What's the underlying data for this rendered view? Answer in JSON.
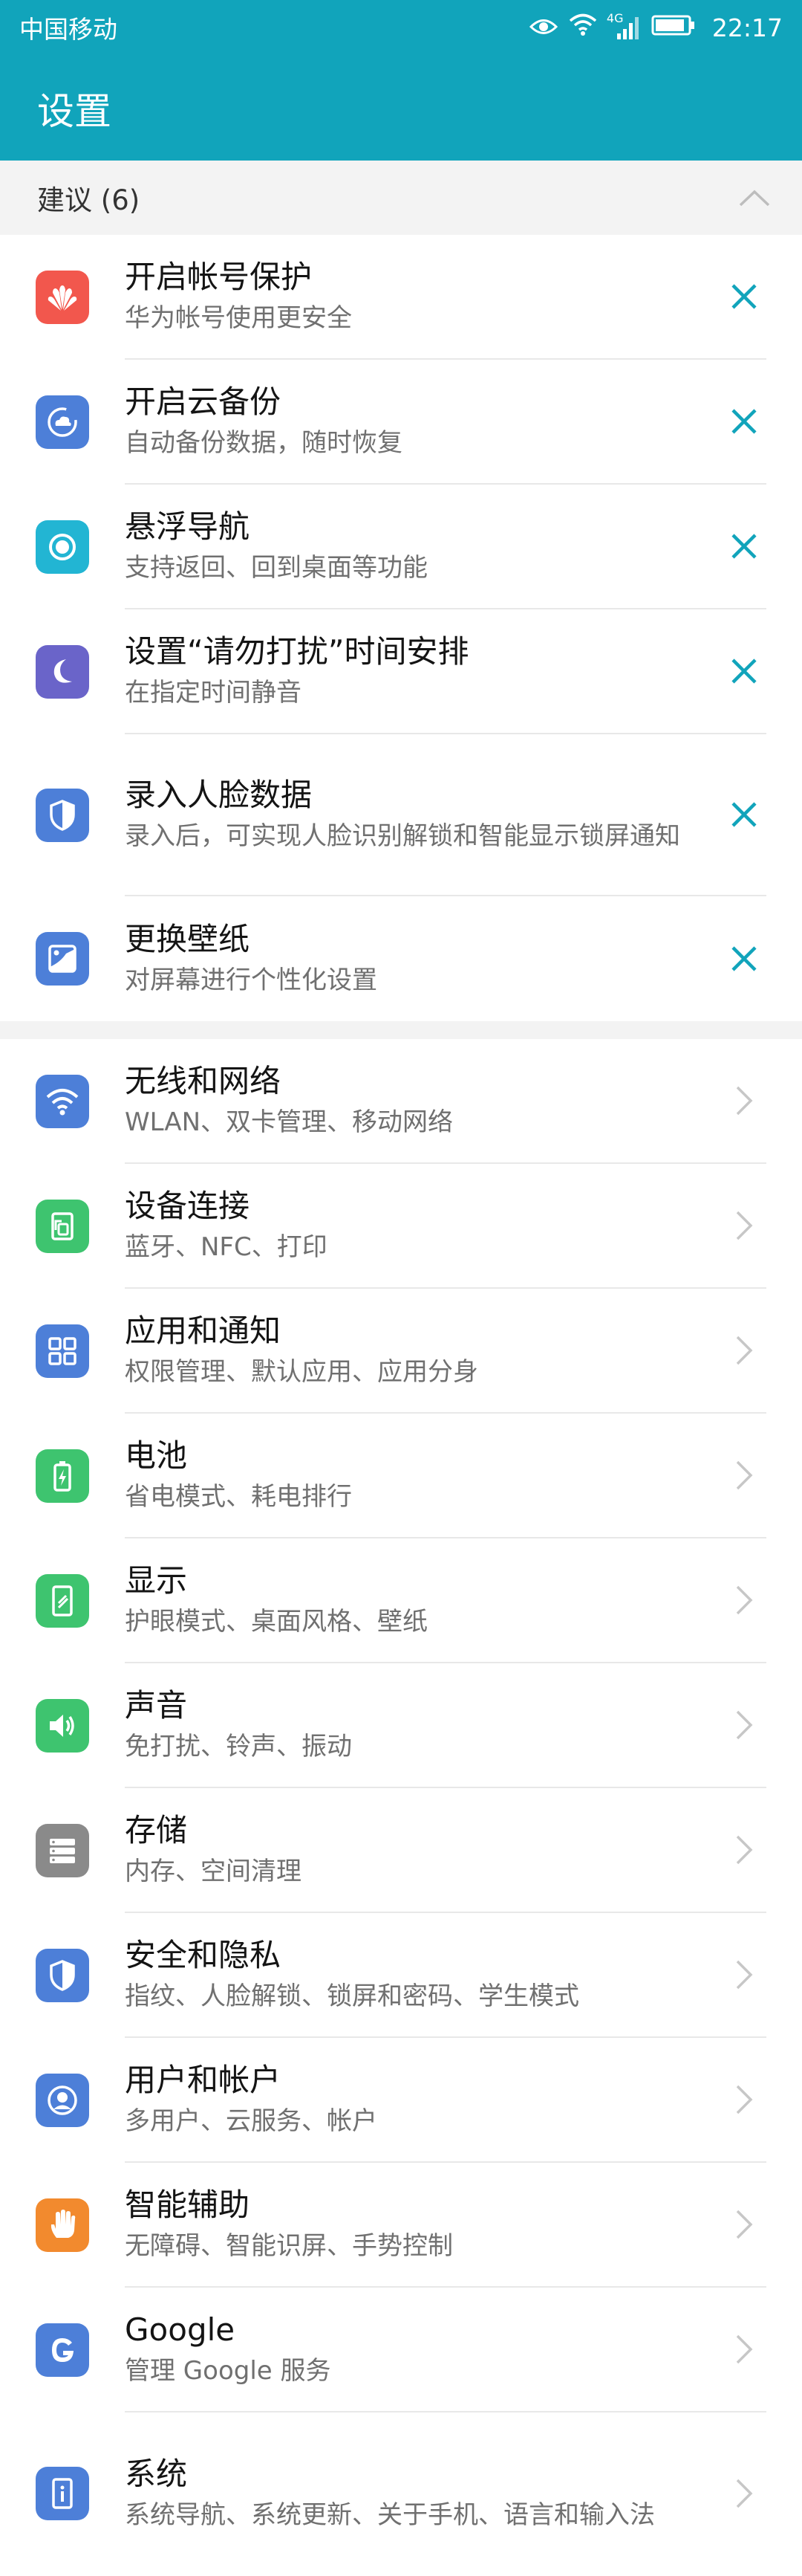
{
  "status_bar": {
    "carrier": "中国移动",
    "time": "22:17",
    "network": "4G"
  },
  "header": {
    "title": "设置"
  },
  "suggestions": {
    "label": "建议 (6)",
    "items": [
      {
        "title": "开启帐号保护",
        "subtitle": "华为帐号使用更安全",
        "icon": "huawei-logo-icon",
        "color": "#f2574d"
      },
      {
        "title": "开启云备份",
        "subtitle": "自动备份数据，随时恢复",
        "icon": "cloud-backup-icon",
        "color": "#4d7fd8"
      },
      {
        "title": "悬浮导航",
        "subtitle": "支持返回、回到桌面等功能",
        "icon": "floating-dock-icon",
        "color": "#22b5d3"
      },
      {
        "title": "设置“请勿打扰”时间安排",
        "subtitle": "在指定时间静音",
        "icon": "moon-icon",
        "color": "#6a64c9"
      },
      {
        "title": "录入人脸数据",
        "subtitle": "录入后，可实现人脸识别解锁和智能显示锁屏通知",
        "icon": "face-shield-icon",
        "color": "#4d7fd8"
      },
      {
        "title": "更换壁纸",
        "subtitle": "对屏幕进行个性化设置",
        "icon": "wallpaper-icon",
        "color": "#4d7fd8"
      }
    ]
  },
  "settings": {
    "items": [
      {
        "title": "无线和网络",
        "subtitle": "WLAN、双卡管理、移动网络",
        "icon": "wifi-icon",
        "color": "#4d7fd8"
      },
      {
        "title": "设备连接",
        "subtitle": "蓝牙、NFC、打印",
        "icon": "device-connect-icon",
        "color": "#3ec46f"
      },
      {
        "title": "应用和通知",
        "subtitle": "权限管理、默认应用、应用分身",
        "icon": "apps-grid-icon",
        "color": "#4d7fd8"
      },
      {
        "title": "电池",
        "subtitle": "省电模式、耗电排行",
        "icon": "battery-icon",
        "color": "#3ec46f"
      },
      {
        "title": "显示",
        "subtitle": "护眼模式、桌面风格、壁纸",
        "icon": "display-icon",
        "color": "#3ec46f"
      },
      {
        "title": "声音",
        "subtitle": "免打扰、铃声、振动",
        "icon": "speaker-icon",
        "color": "#3ec46f"
      },
      {
        "title": "存储",
        "subtitle": "内存、空间清理",
        "icon": "storage-icon",
        "color": "#8a8a8a"
      },
      {
        "title": "安全和隐私",
        "subtitle": "指纹、人脸解锁、锁屏和密码、学生模式",
        "icon": "security-shield-icon",
        "color": "#4d7fd8"
      },
      {
        "title": "用户和帐户",
        "subtitle": "多用户、云服务、帐户",
        "icon": "user-icon",
        "color": "#4d7fd8"
      },
      {
        "title": "智能辅助",
        "subtitle": "无障碍、智能识屏、手势控制",
        "icon": "hand-icon",
        "color": "#f28a2e"
      },
      {
        "title": "Google",
        "subtitle": "管理 Google 服务",
        "icon": "google-icon",
        "color": "#4d7fd8"
      },
      {
        "title": "系统",
        "subtitle": "系统导航、系统更新、关于手机、语言和输入法",
        "icon": "system-info-icon",
        "color": "#4d7fd8"
      }
    ]
  },
  "colors": {
    "header": "#11a4bb",
    "accent": "#11a4bb"
  }
}
